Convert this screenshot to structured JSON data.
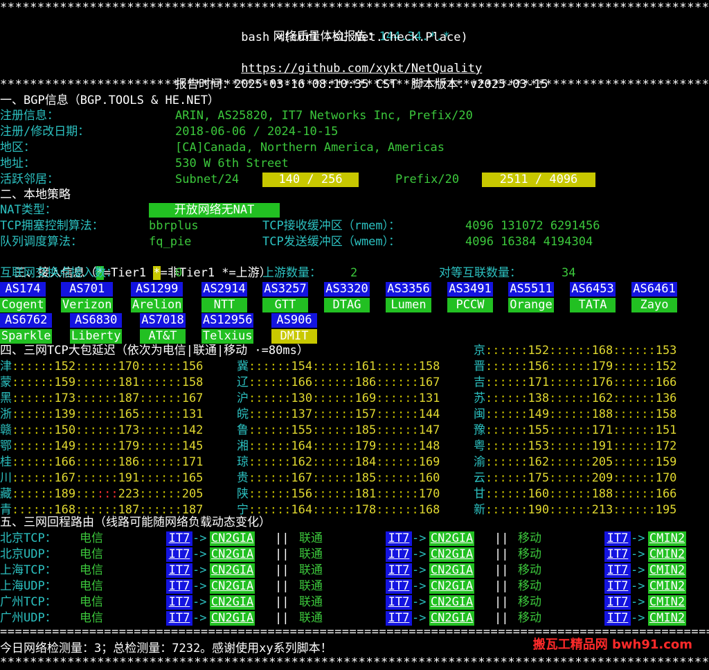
{
  "header": {
    "title_label": "网络质量体检报告：",
    "ip": "144.34.*.*",
    "command": "bash <(curl -sL Net.Check.Place)",
    "repo_url": "https://github.com/xykt/NetQuality",
    "report_time_label": "报告时间：",
    "report_time": "2025-03-16 08:10:35 CST",
    "script_version_label": "脚本版本：",
    "script_version": "v2025-03-15"
  },
  "bgp": {
    "section_title": "一、BGP信息（BGP.TOOLS & HE.NET）",
    "registration_label": "注册信息：",
    "registration": "ARIN, AS25820, IT7 Networks Inc, Prefix/20",
    "dates_label": "注册/修改日期：",
    "dates": "2018-06-06 / 2024-10-15",
    "region_label": "地区：",
    "region": "[CA]Canada, Northern America, Americas",
    "address_label": "地址：",
    "address": "530 W 6th Street",
    "neighbors_label": "活跃邻居：",
    "subnet_label": "Subnet/24",
    "subnet_value": "140 / 256",
    "prefix_label": "Prefix/20",
    "prefix_value": "2511 / 4096"
  },
  "local": {
    "section_title": "二、本地策略",
    "nat_label": "NAT类型：",
    "nat_value": "开放网络无NAT",
    "cc_label": "TCP拥塞控制算法：",
    "cc_value": "bbrplus",
    "rmem_label": "TCP接收缓冲区（rmem）：",
    "rmem_value": "4096 131072 6291456",
    "qdisc_label": "队列调度算法：",
    "qdisc_value": "fq_pie",
    "wmem_label": "TCP发送缓冲区（wmem）：",
    "wmem_value": "4096 16384 4194304"
  },
  "access": {
    "section_title_prefix": "三、接入信息（",
    "legend_star": "*",
    "legend_tier1": "=Tier1 ",
    "legend_nontier1": "=非Tier1 *=上游）",
    "ixp_label": "互联网交换点接入数：",
    "ixp_count": "0",
    "upstream_label": "上游数量：",
    "upstream_count": "2",
    "peer_label": "对等互联数量：",
    "peer_count": "34",
    "peers_row1": [
      {
        "as": "AS174",
        "name": "Cogent"
      },
      {
        "as": "AS701",
        "name": "Verizon"
      },
      {
        "as": "AS1299",
        "name": "Arelion"
      },
      {
        "as": "AS2914",
        "name": "NTT"
      },
      {
        "as": "AS3257",
        "name": "GTT"
      },
      {
        "as": "AS3320",
        "name": "DTAG"
      },
      {
        "as": "AS3356",
        "name": "Lumen"
      },
      {
        "as": "AS3491",
        "name": "PCCW"
      },
      {
        "as": "AS5511",
        "name": "Orange"
      },
      {
        "as": "AS6453",
        "name": "TATA"
      },
      {
        "as": "AS6461",
        "name": "Zayo"
      }
    ],
    "peers_row2": [
      {
        "as": "AS6762",
        "name": "Sparkle"
      },
      {
        "as": "AS6830",
        "name": "Liberty"
      },
      {
        "as": "AS7018",
        "name": "AT&T"
      },
      {
        "as": "AS12956",
        "name": "Telxius"
      },
      {
        "as": "AS906",
        "name": "DMIT"
      }
    ]
  },
  "latency": {
    "section_title": "四、三网TCP大包延迟（依次为电信|联通|移动 ·=80ms）",
    "rows": [
      [
        {
          "p": "",
          "v": []
        },
        {
          "p": "",
          "v": []
        },
        {
          "p": "京",
          "v": [
            "152",
            "168",
            "153"
          ],
          "s": [
            "6",
            "6"
          ]
        }
      ],
      [
        {
          "p": "津",
          "v": [
            "152",
            "170",
            "156"
          ],
          "s": [
            "6",
            "6"
          ]
        },
        {
          "p": "冀",
          "v": [
            "154",
            "161",
            "158"
          ],
          "s": [
            "6",
            "6"
          ]
        },
        {
          "p": "晋",
          "v": [
            "156",
            "179",
            "152"
          ],
          "s": [
            "6",
            "6"
          ]
        }
      ],
      [
        {
          "p": "蒙",
          "v": [
            "159",
            "181",
            "158"
          ],
          "s": [
            "6",
            "6"
          ]
        },
        {
          "p": "辽",
          "v": [
            "166",
            "186",
            "167"
          ],
          "s": [
            "6",
            "6"
          ]
        },
        {
          "p": "吉",
          "v": [
            "171",
            "176",
            "166"
          ],
          "s": [
            "6",
            "6"
          ]
        }
      ],
      [
        {
          "p": "黑",
          "v": [
            "173",
            "187",
            "167"
          ],
          "s": [
            "6",
            "6"
          ]
        },
        {
          "p": "沪",
          "v": [
            "130",
            "169",
            "131"
          ],
          "s": [
            "6",
            "6"
          ]
        },
        {
          "p": "苏",
          "v": [
            "138",
            "162",
            "136"
          ],
          "s": [
            "6",
            "6"
          ]
        }
      ],
      [
        {
          "p": "浙",
          "v": [
            "139",
            "165",
            "131"
          ],
          "s": [
            "6",
            "6"
          ]
        },
        {
          "p": "皖",
          "v": [
            "137",
            "157",
            "144"
          ],
          "s": [
            "6",
            "6"
          ]
        },
        {
          "p": "闽",
          "v": [
            "149",
            "188",
            "158"
          ],
          "s": [
            "6",
            "6"
          ]
        }
      ],
      [
        {
          "p": "赣",
          "v": [
            "150",
            "173",
            "142"
          ],
          "s": [
            "6",
            "6"
          ]
        },
        {
          "p": "鲁",
          "v": [
            "155",
            "185",
            "147"
          ],
          "s": [
            "6",
            "6"
          ]
        },
        {
          "p": "豫",
          "v": [
            "155",
            "171",
            "151"
          ],
          "s": [
            "6",
            "6"
          ]
        }
      ],
      [
        {
          "p": "鄂",
          "v": [
            "149",
            "179",
            "145"
          ],
          "s": [
            "6",
            "6"
          ]
        },
        {
          "p": "湘",
          "v": [
            "164",
            "179",
            "148"
          ],
          "s": [
            "6",
            "6"
          ]
        },
        {
          "p": "粤",
          "v": [
            "153",
            "191",
            "172"
          ],
          "s": [
            "6",
            "6"
          ]
        }
      ],
      [
        {
          "p": "桂",
          "v": [
            "166",
            "186",
            "171"
          ],
          "s": [
            "6",
            "6"
          ]
        },
        {
          "p": "琼",
          "v": [
            "162",
            "184",
            "169"
          ],
          "s": [
            "6",
            "6"
          ]
        },
        {
          "p": "渝",
          "v": [
            "162",
            "205",
            "159"
          ],
          "s": [
            "6",
            "6"
          ]
        }
      ],
      [
        {
          "p": "川",
          "v": [
            "167",
            "191",
            "165"
          ],
          "s": [
            "6",
            "6"
          ]
        },
        {
          "p": "贵",
          "v": [
            "167",
            "185",
            "160"
          ],
          "s": [
            "6",
            "6"
          ]
        },
        {
          "p": "云",
          "v": [
            "175",
            "209",
            "170"
          ],
          "s": [
            "6",
            "6"
          ]
        }
      ],
      [
        {
          "p": "藏",
          "v": [
            "189",
            "223",
            "205"
          ],
          "s": [
            "6",
            "6"
          ],
          "red": true
        },
        {
          "p": "陕",
          "v": [
            "156",
            "181",
            "170"
          ],
          "s": [
            "6",
            "6"
          ]
        },
        {
          "p": "甘",
          "v": [
            "160",
            "188",
            "166"
          ],
          "s": [
            "6",
            "6"
          ]
        }
      ],
      [
        {
          "p": "青",
          "v": [
            "168",
            "187",
            "187"
          ],
          "s": [
            "6",
            "6"
          ]
        },
        {
          "p": "宁",
          "v": [
            "164",
            "178",
            "168"
          ],
          "s": [
            "6",
            "6"
          ]
        },
        {
          "p": "新",
          "v": [
            "190",
            "213",
            "195"
          ],
          "s": [
            "6",
            "6"
          ]
        }
      ]
    ]
  },
  "routes": {
    "section_title": "五、三网回程路由（线路可能随网络负载动态变化）",
    "telecom_label": "电信",
    "unicom_label": "联通",
    "mobile_label": "移动",
    "rows": [
      {
        "city": "北京TCP：",
        "t": [
          "IT7",
          "CN2GIA"
        ],
        "u": [
          "IT7",
          "CN2GIA"
        ],
        "m": [
          "IT7",
          "CMIN2"
        ]
      },
      {
        "city": "北京UDP：",
        "t": [
          "IT7",
          "CN2GIA"
        ],
        "u": [
          "IT7",
          "CN2GIA"
        ],
        "m": [
          "IT7",
          "CMIN2"
        ]
      },
      {
        "city": "上海TCP：",
        "t": [
          "IT7",
          "CN2GIA"
        ],
        "u": [
          "IT7",
          "CN2GIA"
        ],
        "m": [
          "IT7",
          "CMIN2"
        ]
      },
      {
        "city": "上海UDP：",
        "t": [
          "IT7",
          "CN2GIA"
        ],
        "u": [
          "IT7",
          "CN2GIA"
        ],
        "m": [
          "IT7",
          "CMIN2"
        ]
      },
      {
        "city": "广州TCP：",
        "t": [
          "IT7",
          "CN2GIA"
        ],
        "u": [
          "IT7",
          "CN2GIA"
        ],
        "m": [
          "IT7",
          "CMIN2"
        ]
      },
      {
        "city": "广州UDP：",
        "t": [
          "IT7",
          "CN2GIA"
        ],
        "u": [
          "IT7",
          "CN2GIA"
        ],
        "m": [
          "IT7",
          "CMIN2"
        ]
      }
    ]
  },
  "footer": {
    "stats": "今日网络检测量：3；总检测量：7232。感谢使用xy系列脚本！",
    "watermark": "搬瓦工精品网 bwh91.com"
  }
}
